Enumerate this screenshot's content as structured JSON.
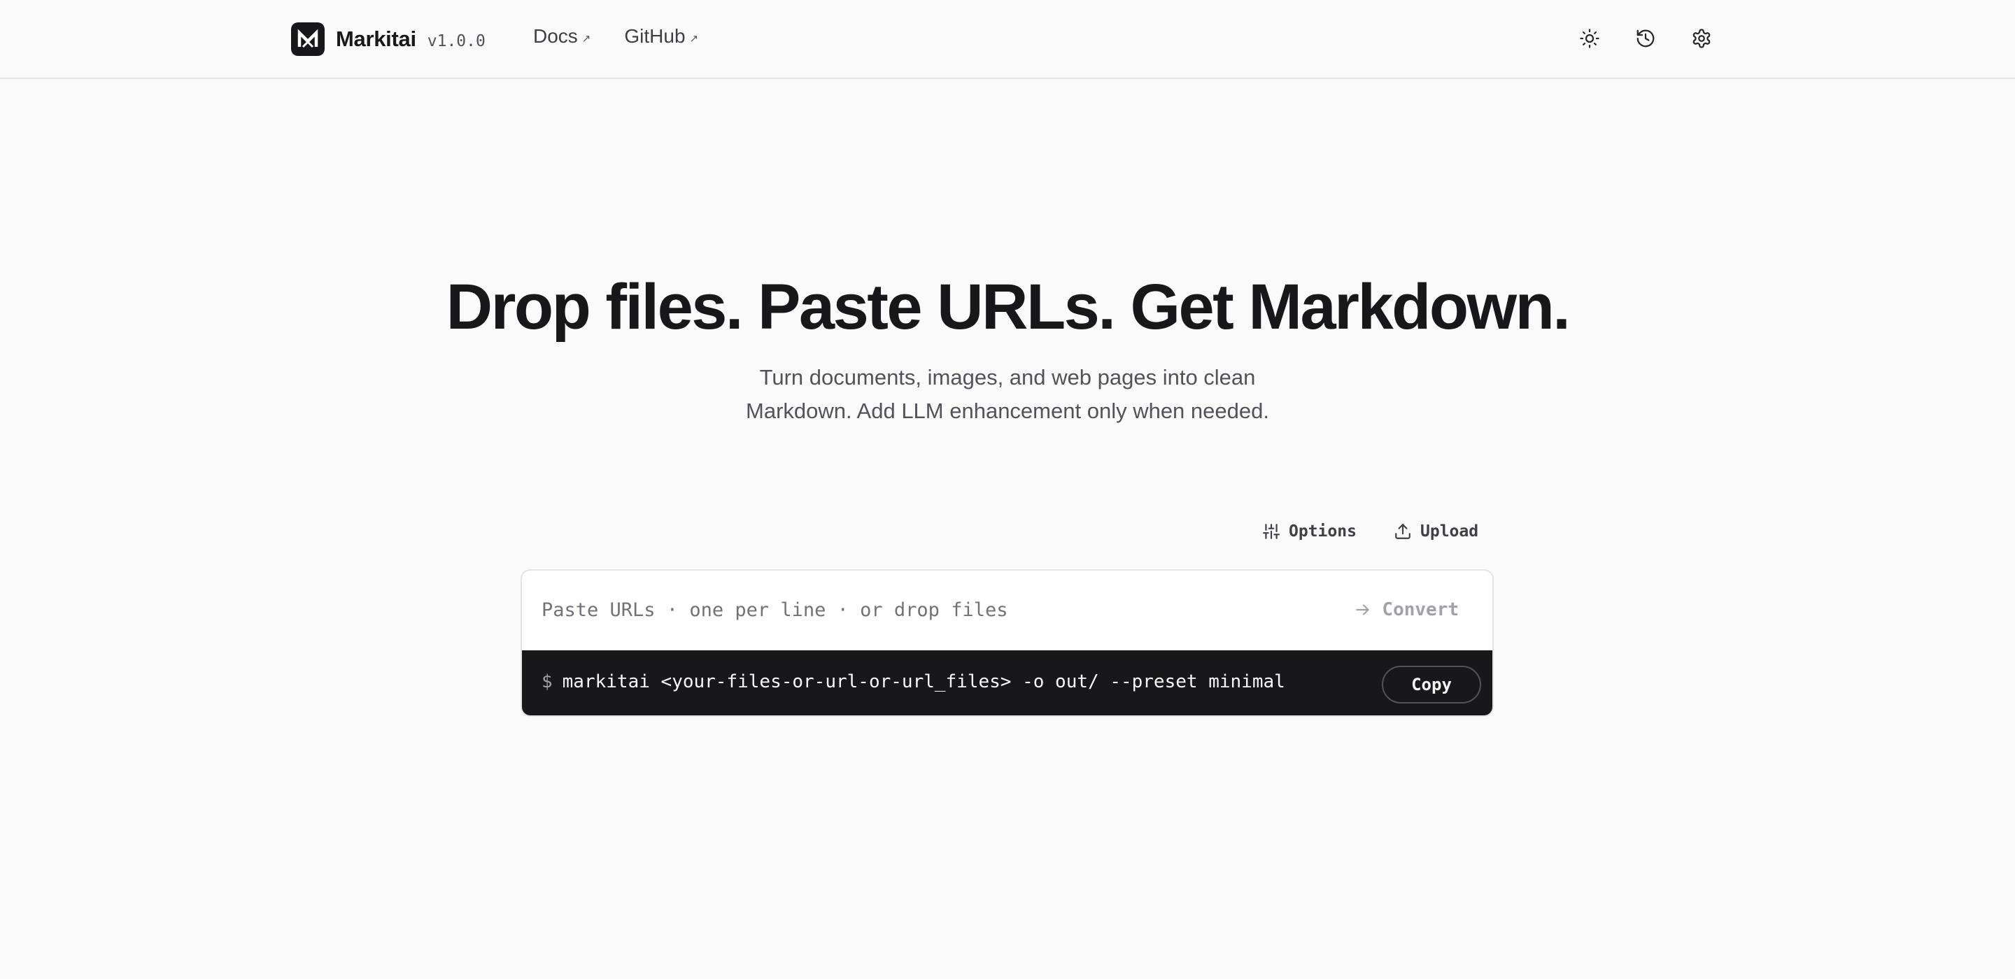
{
  "header": {
    "brand_name": "Markitai",
    "version": "v1.0.0",
    "nav": [
      {
        "label": "Docs",
        "icon": "external-link-arrow"
      },
      {
        "label": "GitHub",
        "icon": "external-link-arrow"
      }
    ],
    "actions": [
      "sun-icon",
      "history-icon",
      "gear-icon"
    ]
  },
  "hero": {
    "title": "Drop files. Paste URLs. Get Markdown.",
    "subtitle_line1": "Turn documents, images, and web pages into clean",
    "subtitle_line2": "Markdown. Add LLM enhancement only when needed."
  },
  "toolbar": {
    "options_label": "Options",
    "upload_label": "Upload"
  },
  "input": {
    "placeholder": "Paste URLs · one per line · or drop files",
    "value": "",
    "convert_label": "Convert"
  },
  "command": {
    "prompt": "$",
    "text": "markitai <your-files-or-url-or-url_files> -o out/ --preset minimal",
    "copy_label": "Copy"
  },
  "colors": {
    "background": "#fafafa",
    "primary": "#18181b",
    "muted": "#52525b",
    "border": "#e4e4e7"
  }
}
